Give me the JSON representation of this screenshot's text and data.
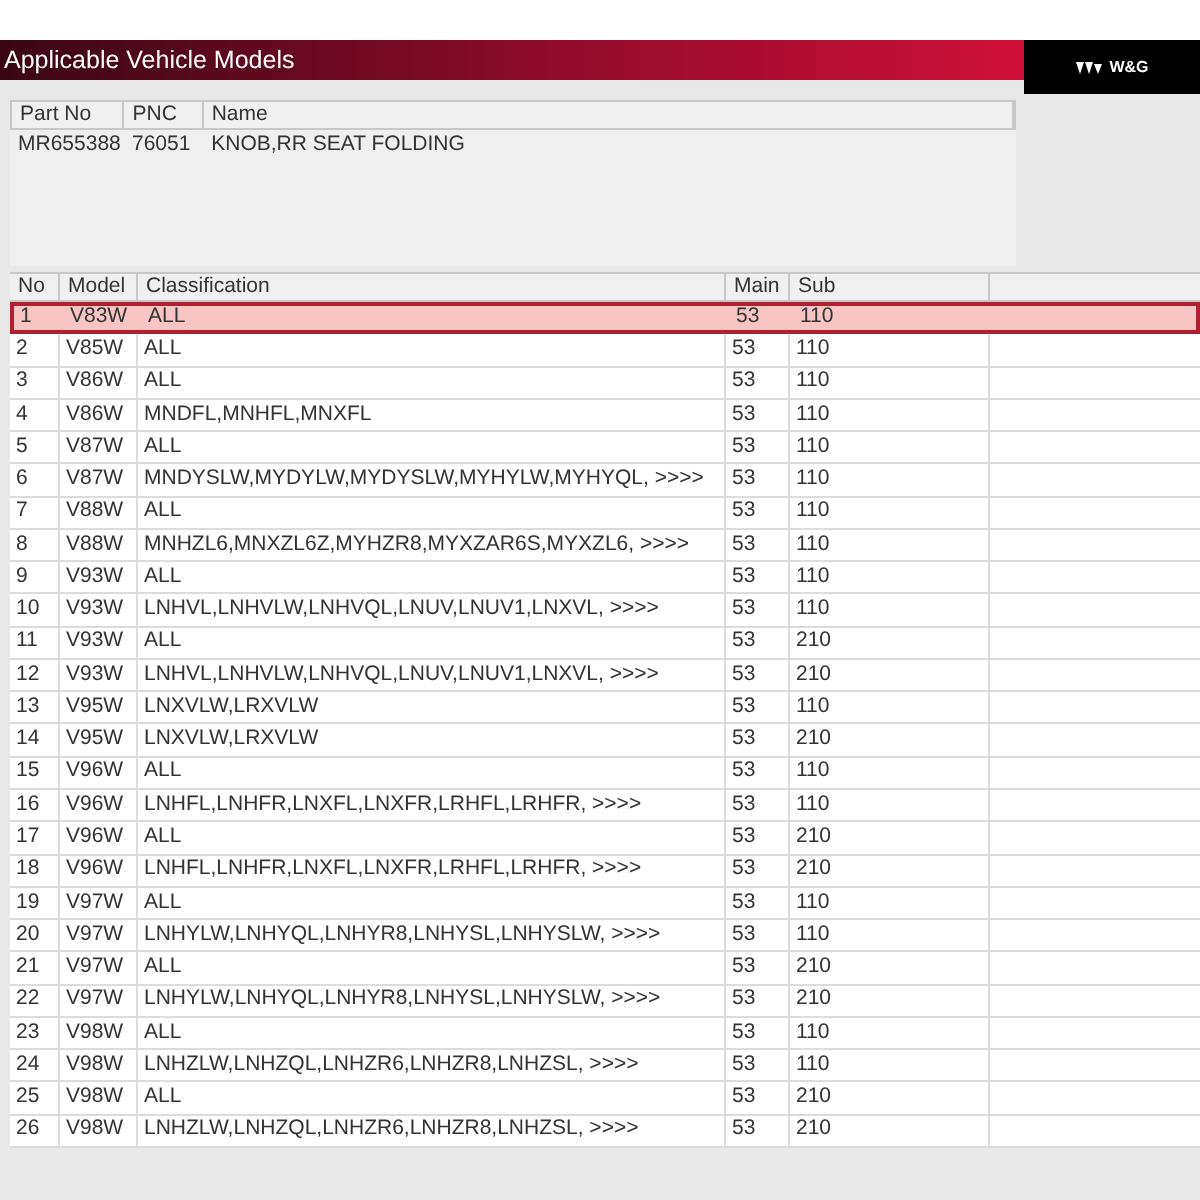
{
  "window": {
    "title": "Applicable Vehicle Models"
  },
  "logo": {
    "text": "W&G"
  },
  "part_table": {
    "columns": [
      "Part No",
      "PNC",
      "Name"
    ],
    "rows": [
      {
        "part_no": "MR655388",
        "pnc": "76051",
        "name": "KNOB,RR SEAT FOLDING"
      }
    ]
  },
  "models_table": {
    "columns": [
      "No",
      "Model",
      "Classification",
      "Main",
      "Sub"
    ],
    "rows": [
      {
        "no": "1",
        "model": "V83W",
        "classification": "ALL",
        "main": "53",
        "sub": "110",
        "selected": true
      },
      {
        "no": "2",
        "model": "V85W",
        "classification": "ALL",
        "main": "53",
        "sub": "110",
        "selected": false
      },
      {
        "no": "3",
        "model": "V86W",
        "classification": "ALL",
        "main": "53",
        "sub": "110",
        "selected": false
      },
      {
        "no": "4",
        "model": "V86W",
        "classification": "MNDFL,MNHFL,MNXFL",
        "main": "53",
        "sub": "110",
        "selected": false
      },
      {
        "no": "5",
        "model": "V87W",
        "classification": "ALL",
        "main": "53",
        "sub": "110",
        "selected": false
      },
      {
        "no": "6",
        "model": "V87W",
        "classification": "MNDYSLW,MYDYLW,MYDYSLW,MYHYLW,MYHYQL, >>>>",
        "main": "53",
        "sub": "110",
        "selected": false
      },
      {
        "no": "7",
        "model": "V88W",
        "classification": "ALL",
        "main": "53",
        "sub": "110",
        "selected": false
      },
      {
        "no": "8",
        "model": "V88W",
        "classification": "MNHZL6,MNXZL6Z,MYHZR8,MYXZAR6S,MYXZL6, >>>>",
        "main": "53",
        "sub": "110",
        "selected": false
      },
      {
        "no": "9",
        "model": "V93W",
        "classification": "ALL",
        "main": "53",
        "sub": "110",
        "selected": false
      },
      {
        "no": "10",
        "model": "V93W",
        "classification": "LNHVL,LNHVLW,LNHVQL,LNUV,LNUV1,LNXVL, >>>>",
        "main": "53",
        "sub": "110",
        "selected": false
      },
      {
        "no": "11",
        "model": "V93W",
        "classification": "ALL",
        "main": "53",
        "sub": "210",
        "selected": false
      },
      {
        "no": "12",
        "model": "V93W",
        "classification": "LNHVL,LNHVLW,LNHVQL,LNUV,LNUV1,LNXVL, >>>>",
        "main": "53",
        "sub": "210",
        "selected": false
      },
      {
        "no": "13",
        "model": "V95W",
        "classification": "LNXVLW,LRXVLW",
        "main": "53",
        "sub": "110",
        "selected": false
      },
      {
        "no": "14",
        "model": "V95W",
        "classification": "LNXVLW,LRXVLW",
        "main": "53",
        "sub": "210",
        "selected": false
      },
      {
        "no": "15",
        "model": "V96W",
        "classification": "ALL",
        "main": "53",
        "sub": "110",
        "selected": false
      },
      {
        "no": "16",
        "model": "V96W",
        "classification": "LNHFL,LNHFR,LNXFL,LNXFR,LRHFL,LRHFR, >>>>",
        "main": "53",
        "sub": "110",
        "selected": false
      },
      {
        "no": "17",
        "model": "V96W",
        "classification": "ALL",
        "main": "53",
        "sub": "210",
        "selected": false
      },
      {
        "no": "18",
        "model": "V96W",
        "classification": "LNHFL,LNHFR,LNXFL,LNXFR,LRHFL,LRHFR, >>>>",
        "main": "53",
        "sub": "210",
        "selected": false
      },
      {
        "no": "19",
        "model": "V97W",
        "classification": "ALL",
        "main": "53",
        "sub": "110",
        "selected": false
      },
      {
        "no": "20",
        "model": "V97W",
        "classification": "LNHYLW,LNHYQL,LNHYR8,LNHYSL,LNHYSLW, >>>>",
        "main": "53",
        "sub": "110",
        "selected": false
      },
      {
        "no": "21",
        "model": "V97W",
        "classification": "ALL",
        "main": "53",
        "sub": "210",
        "selected": false
      },
      {
        "no": "22",
        "model": "V97W",
        "classification": "LNHYLW,LNHYQL,LNHYR8,LNHYSL,LNHYSLW, >>>>",
        "main": "53",
        "sub": "210",
        "selected": false
      },
      {
        "no": "23",
        "model": "V98W",
        "classification": "ALL",
        "main": "53",
        "sub": "110",
        "selected": false
      },
      {
        "no": "24",
        "model": "V98W",
        "classification": "LNHZLW,LNHZQL,LNHZR6,LNHZR8,LNHZSL, >>>>",
        "main": "53",
        "sub": "110",
        "selected": false
      },
      {
        "no": "25",
        "model": "V98W",
        "classification": "ALL",
        "main": "53",
        "sub": "210",
        "selected": false
      },
      {
        "no": "26",
        "model": "V98W",
        "classification": "LNHZLW,LNHZQL,LNHZR6,LNHZR8,LNHZSL, >>>>",
        "main": "53",
        "sub": "210",
        "selected": false
      }
    ]
  }
}
